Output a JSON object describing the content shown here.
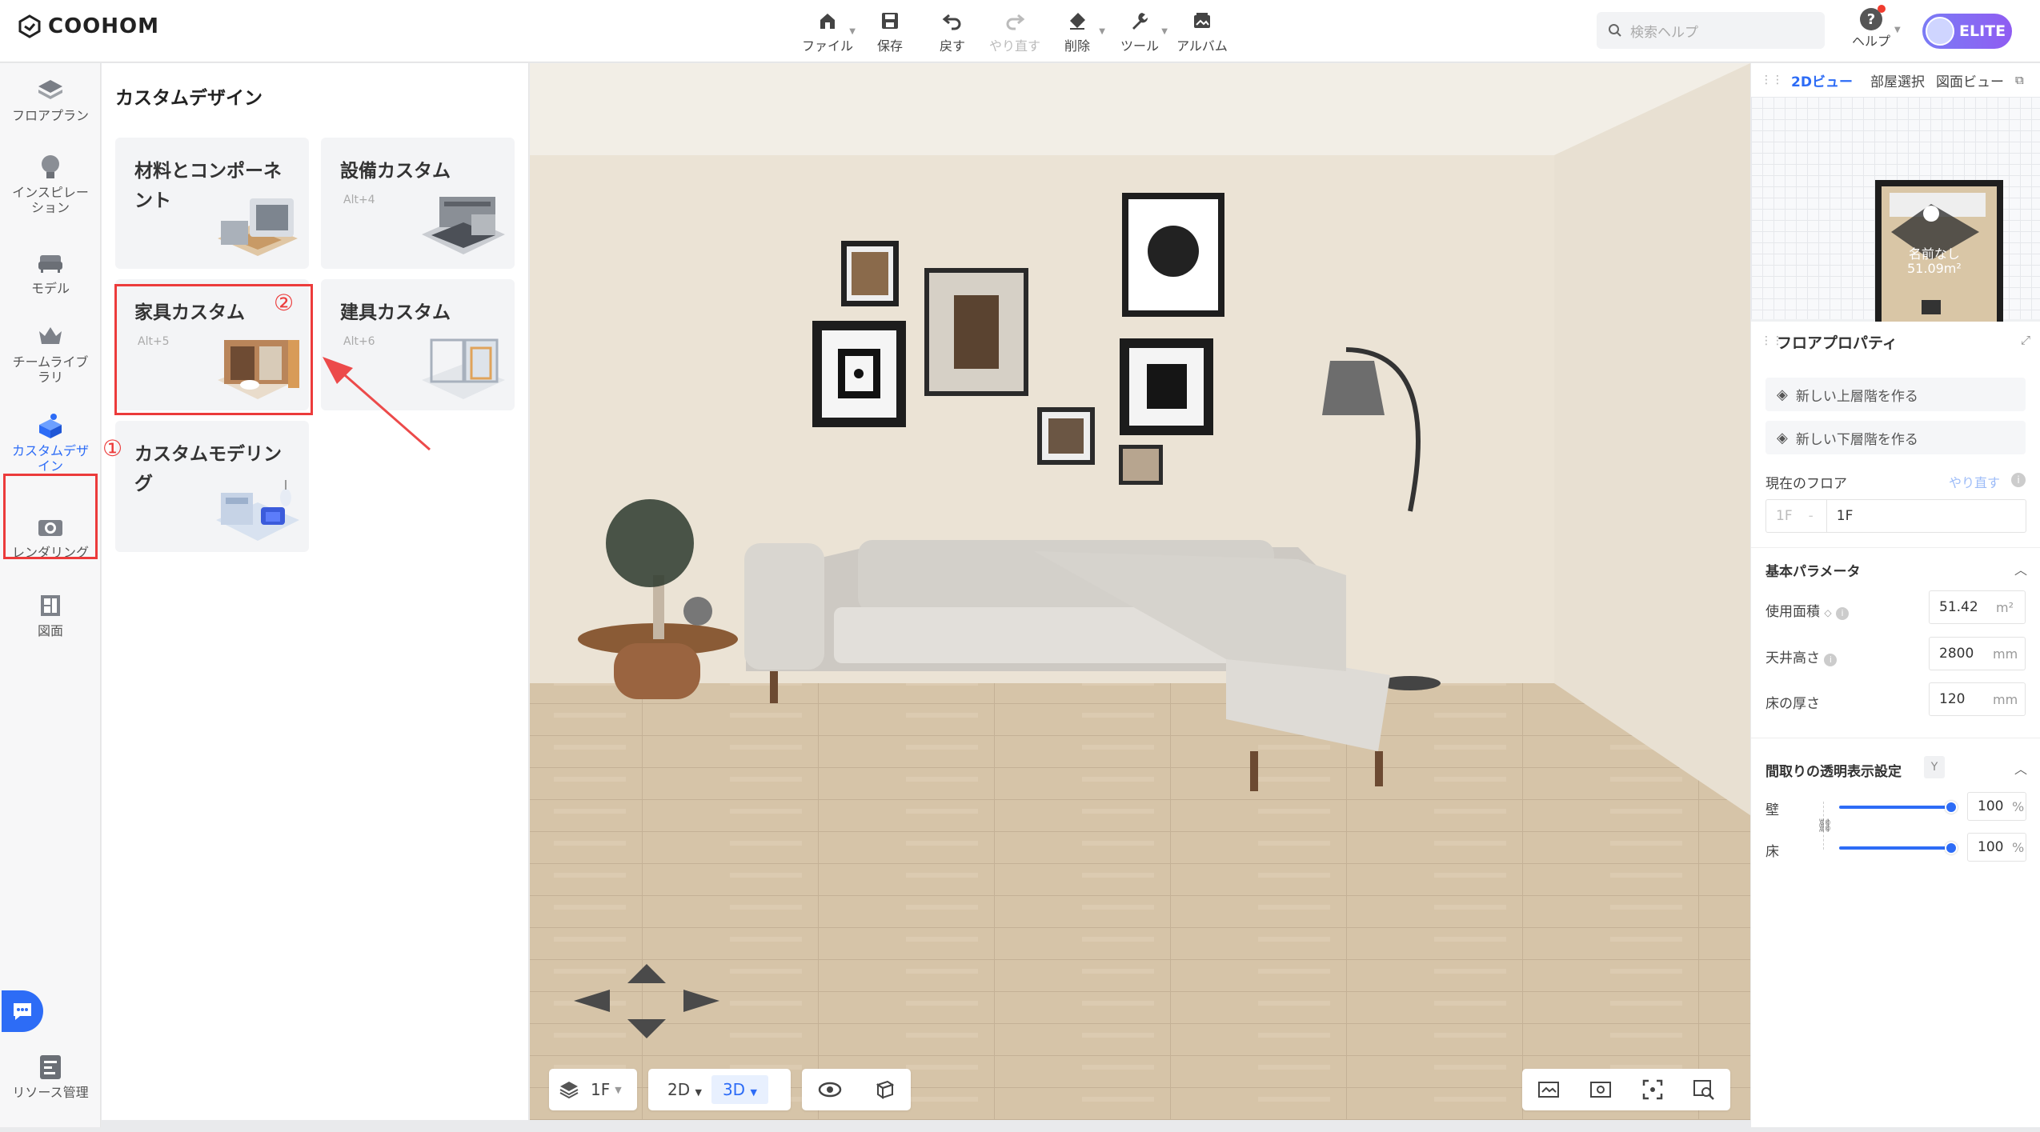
{
  "app": {
    "logo": "COOHOM"
  },
  "toolbar": [
    {
      "label": "ファイル",
      "icon": "home-file-icon",
      "caret": true,
      "disabled": false
    },
    {
      "label": "保存",
      "icon": "save-icon",
      "caret": false,
      "disabled": false
    },
    {
      "label": "戻す",
      "icon": "undo-icon",
      "caret": false,
      "disabled": false
    },
    {
      "label": "やり直す",
      "icon": "redo-icon",
      "caret": false,
      "disabled": true
    },
    {
      "label": "削除",
      "icon": "eraser-icon",
      "caret": true,
      "disabled": false
    },
    {
      "label": "ツール",
      "icon": "wrench-icon",
      "caret": true,
      "disabled": false
    },
    {
      "label": "アルバム",
      "icon": "album-icon",
      "caret": false,
      "disabled": false
    }
  ],
  "search": {
    "placeholder": "検索ヘルプ"
  },
  "help": {
    "label": "ヘルプ",
    "icon": "?"
  },
  "account": {
    "badge": "ELITE"
  },
  "nav": [
    {
      "label": "フロアプラン",
      "icon": "floorplan-icon"
    },
    {
      "label": "インスピレーション",
      "icon": "lightbulb-icon"
    },
    {
      "label": "モデル",
      "icon": "sofa-icon"
    },
    {
      "label": "チームライブラリ",
      "icon": "crown-icon"
    },
    {
      "label": "カスタムデザイン",
      "icon": "custom-design-icon",
      "active": true
    },
    {
      "label": "レンダリング",
      "icon": "camera-icon"
    },
    {
      "label": "図面",
      "icon": "blueprint-icon"
    }
  ],
  "nav_bottom": {
    "label": "リソース管理"
  },
  "panel": {
    "title": "カスタムデザイン",
    "cards": [
      {
        "title": "材料とコンポーネント",
        "shortcut": ""
      },
      {
        "title": "設備カスタム",
        "shortcut": "Alt+4"
      },
      {
        "title": "家具カスタム",
        "shortcut": "Alt+5"
      },
      {
        "title": "建具カスタム",
        "shortcut": "Alt+6"
      },
      {
        "title": "カスタムモデリング",
        "shortcut": ""
      }
    ]
  },
  "annotations": {
    "step1": "①",
    "step2": "②"
  },
  "viewport": {
    "floor": "1F",
    "mode2d": "2D",
    "mode3d": "3D"
  },
  "minimap": {
    "tabs": [
      "2Dビュー",
      "部屋選択",
      "図面ビュー"
    ],
    "room_name": "名前なし",
    "room_area": "51.09m²"
  },
  "props": {
    "title": "フロアプロパティ",
    "add_above": "新しい上層階を作る",
    "add_below": "新しい下層階を作る",
    "current_floor_label": "現在のフロア",
    "redo": "やり直す",
    "floor_prefix": "1F",
    "floor_value": "1F",
    "basic_title": "基本パラメータ",
    "area_label": "使用面積",
    "area_value": "51.42",
    "area_unit": "m²",
    "ceiling_label": "天井高さ",
    "ceiling_value": "2800",
    "ceiling_unit": "mm",
    "floor_thick_label": "床の厚さ",
    "floor_thick_value": "120",
    "floor_thick_unit": "mm",
    "transparency_title": "間取りの透明表示設定",
    "transparency_key": "Y",
    "wall_label": "壁",
    "wall_value": "100",
    "floor2_label": "床",
    "floor2_value": "100",
    "percent": "%"
  },
  "colors": {
    "accent": "#2d6cf6",
    "highlight": "#ec3b3b",
    "elite": "#8466f3"
  }
}
